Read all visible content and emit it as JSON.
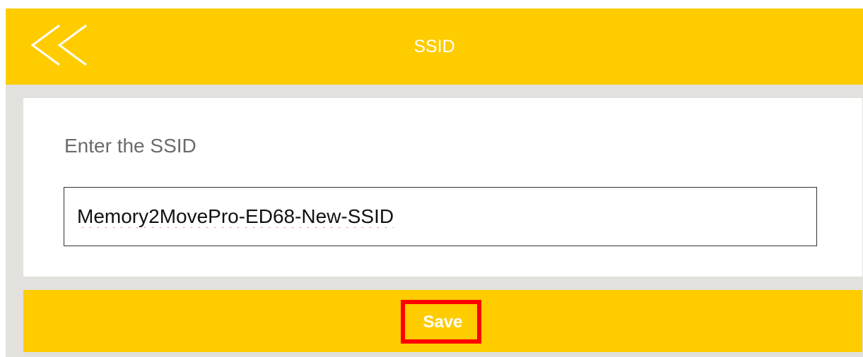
{
  "header": {
    "title": "SSID",
    "back_icon": "double-chevron-left-icon"
  },
  "form": {
    "prompt": "Enter the SSID",
    "ssid_value": "Memory2MovePro-ED68-New-SSID"
  },
  "actions": {
    "save_label": "Save"
  },
  "colors": {
    "accent": "#ffcc00",
    "background": "#e2e1dd",
    "highlight": "#ff0000",
    "spellcheck": "#e53935"
  }
}
